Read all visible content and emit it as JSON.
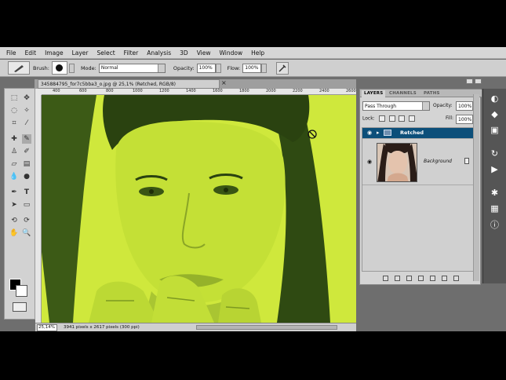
{
  "menu": [
    "File",
    "Edit",
    "Image",
    "Layer",
    "Select",
    "Filter",
    "Analysis",
    "3D",
    "View",
    "Window",
    "Help"
  ],
  "options_bar": {
    "brush_label": "Brush:",
    "brush_size": "",
    "mode_label": "Mode:",
    "mode_value": "Normal",
    "opacity_label": "Opacity:",
    "opacity_value": "100%",
    "flow_label": "Flow:",
    "flow_value": "100%"
  },
  "document": {
    "tab_title": "345884795_for7c5bba3_o.jpg @ 25,1% (Retched, RGB/8)",
    "close_glyph": "×",
    "zoom": "25,14%",
    "doc_info": "3941 pixels x 2617 pixels (300 ppi)"
  },
  "ruler": {
    "top_ticks": [
      "400",
      "600",
      "800",
      "1000",
      "1200",
      "1400",
      "1600",
      "1800",
      "2000",
      "2200",
      "2400",
      "2600"
    ]
  },
  "layers_panel": {
    "tabs": [
      "LAYERS",
      "CHANNELS",
      "PATHS"
    ],
    "blend_mode": "Pass Through",
    "opacity_label": "Opacity:",
    "opacity_value": "100%",
    "lock_label": "Lock:",
    "fill_label": "Fill:",
    "fill_value": "100%",
    "layers": [
      {
        "name": "Retched",
        "type": "group",
        "selected": true
      },
      {
        "name": "Background",
        "type": "image",
        "selected": false
      }
    ]
  },
  "colors": {
    "canvas_tint": "#d7ef3f",
    "selected_layer": "#0c4f7a",
    "hair": "#2f4a12"
  }
}
